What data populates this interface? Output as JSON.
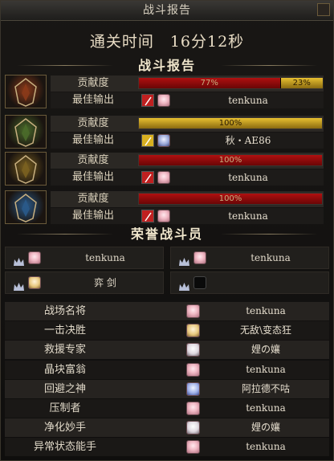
{
  "window": {
    "title": "战斗报告"
  },
  "clear_time": "通关时间　16分12秒",
  "sections": {
    "report": "战斗报告",
    "honor": "荣誉战斗员"
  },
  "labels": {
    "contribution": "贡献度",
    "best_output": "最佳输出"
  },
  "heroes": [
    {
      "portrait": "flame-helm-icon",
      "tint": "#8a3a1a",
      "contribution": [
        {
          "pct": 77,
          "label": "77%",
          "color": "red"
        },
        {
          "pct": 23,
          "label": "23%",
          "color": "gold"
        }
      ],
      "weapon_color": "#c02020",
      "best_player": "tenkuna",
      "avatar": "pink-hair-avatar"
    },
    {
      "portrait": "green-helm-icon",
      "tint": "#4a6a2a",
      "contribution": [
        {
          "pct": 100,
          "label": "100%",
          "color": "gold"
        }
      ],
      "weapon_color": "#d8b020",
      "best_player": "秋・AE86",
      "avatar": "silver-hair-avatar"
    },
    {
      "portrait": "gold-helm-icon",
      "tint": "#7a6020",
      "contribution": [
        {
          "pct": 100,
          "label": "100%",
          "color": "red"
        }
      ],
      "weapon_color": "#c02020",
      "best_player": "tenkuna",
      "avatar": "pink-hair-avatar"
    },
    {
      "portrait": "ice-helm-icon",
      "tint": "#2a5a8a",
      "contribution": [
        {
          "pct": 100,
          "label": "100%",
          "color": "red"
        }
      ],
      "weapon_color": "#c02020",
      "best_player": "tenkuna",
      "avatar": "pink-hair-avatar"
    }
  ],
  "honor_players": [
    {
      "name": "tenkuna",
      "avatar": "pink-hair-avatar"
    },
    {
      "name": "tenkuna",
      "avatar": "pink-hair-avatar"
    },
    {
      "name": "弈 剑",
      "avatar": "blonde-hair-avatar"
    },
    {
      "name": "",
      "avatar": "empty-slot"
    }
  ],
  "awards": [
    {
      "title": "战场名将",
      "player": "tenkuna",
      "avatar": "pink"
    },
    {
      "title": "一击决胜",
      "player": "无敌\\变态狂",
      "avatar": "blonde"
    },
    {
      "title": "救援专家",
      "player": "娌の孃",
      "avatar": "white"
    },
    {
      "title": "晶块富翁",
      "player": "tenkuna",
      "avatar": "pink"
    },
    {
      "title": "回避之神",
      "player": "阿拉德不咕",
      "avatar": "blue"
    },
    {
      "title": "压制者",
      "player": "tenkuna",
      "avatar": "pink"
    },
    {
      "title": "净化妙手",
      "player": "娌の孃",
      "avatar": "white"
    },
    {
      "title": "异常状态能手",
      "player": "tenkuna",
      "avatar": "pink"
    }
  ],
  "colors": {
    "red_bar": "#b01010",
    "gold_bar": "#e8c030",
    "accent_text": "#f0e6cc"
  }
}
